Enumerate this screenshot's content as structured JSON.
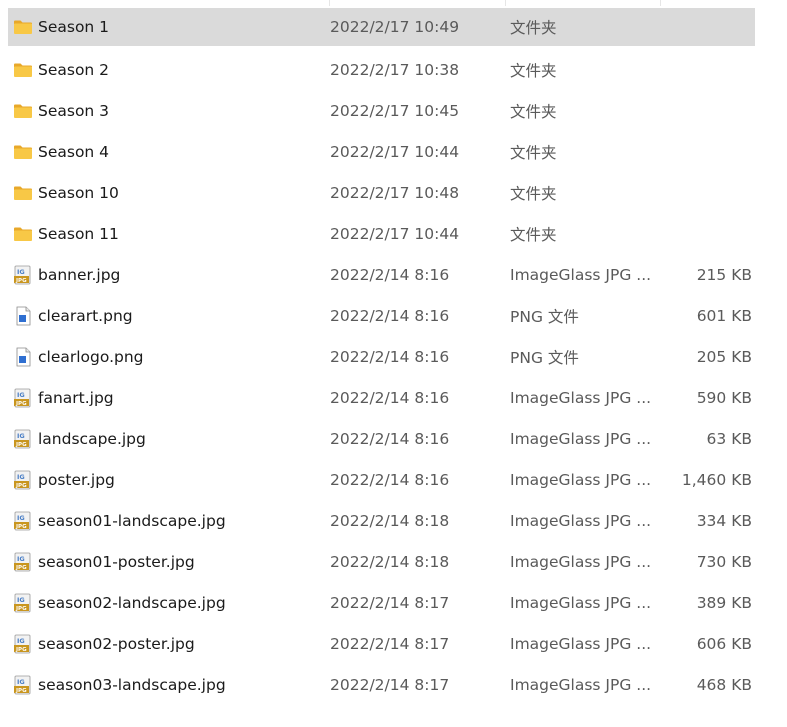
{
  "files": [
    {
      "name": "Season 1",
      "date": "2022/2/17 10:49",
      "type": "文件夹",
      "size": "",
      "icon": "folder-icon",
      "selected": true
    },
    {
      "name": "Season 2",
      "date": "2022/2/17 10:38",
      "type": "文件夹",
      "size": "",
      "icon": "folder-icon"
    },
    {
      "name": "Season 3",
      "date": "2022/2/17 10:45",
      "type": "文件夹",
      "size": "",
      "icon": "folder-icon"
    },
    {
      "name": "Season 4",
      "date": "2022/2/17 10:44",
      "type": "文件夹",
      "size": "",
      "icon": "folder-icon"
    },
    {
      "name": "Season 10",
      "date": "2022/2/17 10:48",
      "type": "文件夹",
      "size": "",
      "icon": "folder-icon"
    },
    {
      "name": "Season 11",
      "date": "2022/2/17 10:44",
      "type": "文件夹",
      "size": "",
      "icon": "folder-icon"
    },
    {
      "name": "banner.jpg",
      "date": "2022/2/14 8:16",
      "type": "ImageGlass JPG ...",
      "size": "215 KB",
      "icon": "jpg-file-icon"
    },
    {
      "name": "clearart.png",
      "date": "2022/2/14 8:16",
      "type": "PNG 文件",
      "size": "601 KB",
      "icon": "png-file-icon"
    },
    {
      "name": "clearlogo.png",
      "date": "2022/2/14 8:16",
      "type": "PNG 文件",
      "size": "205 KB",
      "icon": "png-file-icon"
    },
    {
      "name": "fanart.jpg",
      "date": "2022/2/14 8:16",
      "type": "ImageGlass JPG ...",
      "size": "590 KB",
      "icon": "jpg-file-icon"
    },
    {
      "name": "landscape.jpg",
      "date": "2022/2/14 8:16",
      "type": "ImageGlass JPG ...",
      "size": "63 KB",
      "icon": "jpg-file-icon"
    },
    {
      "name": "poster.jpg",
      "date": "2022/2/14 8:16",
      "type": "ImageGlass JPG ...",
      "size": "1,460 KB",
      "icon": "jpg-file-icon"
    },
    {
      "name": "season01-landscape.jpg",
      "date": "2022/2/14 8:18",
      "type": "ImageGlass JPG ...",
      "size": "334 KB",
      "icon": "jpg-file-icon"
    },
    {
      "name": "season01-poster.jpg",
      "date": "2022/2/14 8:18",
      "type": "ImageGlass JPG ...",
      "size": "730 KB",
      "icon": "jpg-file-icon"
    },
    {
      "name": "season02-landscape.jpg",
      "date": "2022/2/14 8:17",
      "type": "ImageGlass JPG ...",
      "size": "389 KB",
      "icon": "jpg-file-icon"
    },
    {
      "name": "season02-poster.jpg",
      "date": "2022/2/14 8:17",
      "type": "ImageGlass JPG ...",
      "size": "606 KB",
      "icon": "jpg-file-icon"
    },
    {
      "name": "season03-landscape.jpg",
      "date": "2022/2/14 8:17",
      "type": "ImageGlass JPG ...",
      "size": "468 KB",
      "icon": "jpg-file-icon"
    }
  ],
  "colors": {
    "selected_row_bg": "#dadada",
    "folder_fill": "#f8c846",
    "folder_tab": "#e8a82a",
    "jpg_badge": "#c9961f",
    "png_accent": "#2f6fd1"
  }
}
